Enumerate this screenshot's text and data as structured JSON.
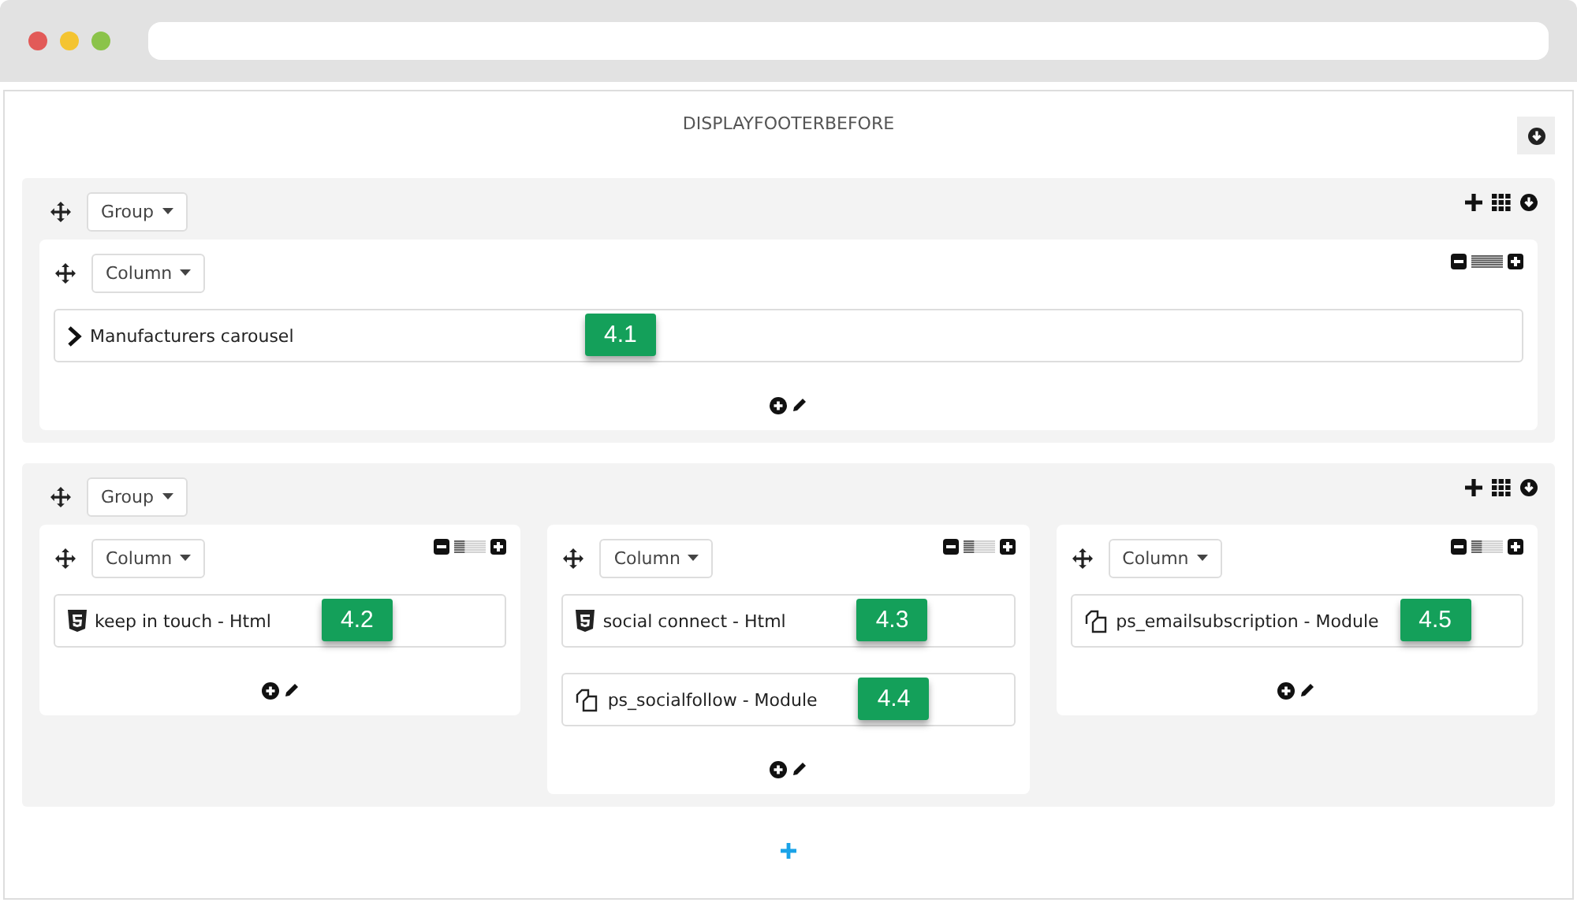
{
  "hook": {
    "title": "DISPLAYFOOTERBEFORE"
  },
  "groups": [
    {
      "label": "Group",
      "columns": [
        {
          "label": "Column",
          "level": 1,
          "modules": [
            {
              "kind": "chevron",
              "name": "Manufacturers carousel",
              "badge": "4.1"
            }
          ]
        }
      ]
    },
    {
      "label": "Group",
      "columns": [
        {
          "label": "Column",
          "level": 0.333,
          "modules": [
            {
              "kind": "html",
              "name": "keep in touch - Html",
              "badge": "4.2"
            }
          ]
        },
        {
          "label": "Column",
          "level": 0.333,
          "modules": [
            {
              "kind": "html",
              "name": "social connect - Html",
              "badge": "4.3"
            },
            {
              "kind": "module",
              "name": "ps_socialfollow - Module",
              "badge": "4.4"
            }
          ]
        },
        {
          "label": "Column",
          "level": 0.333,
          "modules": [
            {
              "kind": "module",
              "name": "ps_emailsubscription - Module",
              "badge": "4.5"
            }
          ]
        }
      ]
    }
  ]
}
